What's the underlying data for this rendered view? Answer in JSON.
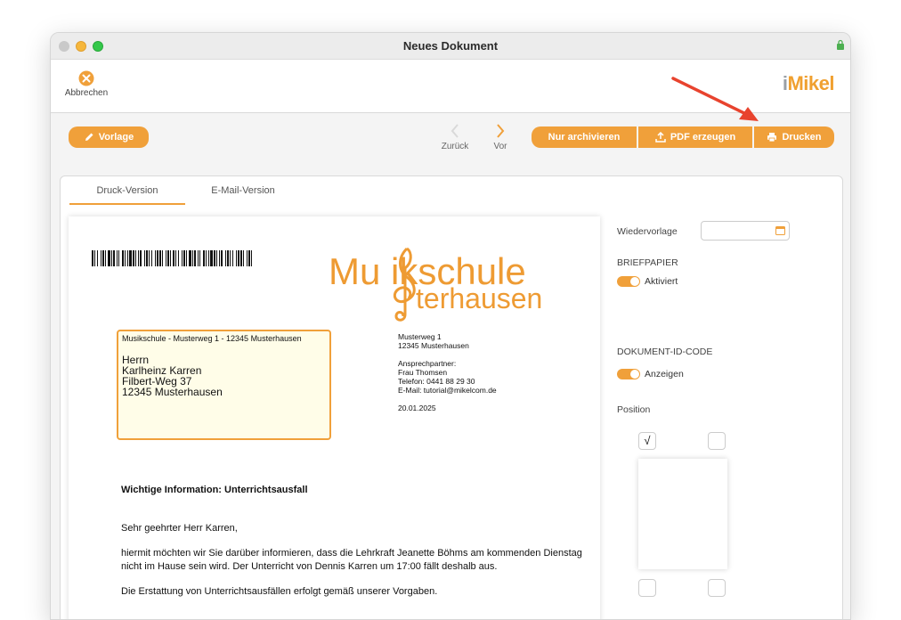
{
  "window": {
    "title": "Neues Dokument"
  },
  "toolbar": {
    "cancel_label": "Abbrechen",
    "logo_i": "i",
    "logo_text": "Mikel"
  },
  "actions": {
    "vorlage": "Vorlage",
    "zurueck": "Zurück",
    "vor": "Vor",
    "archivieren": "Nur archivieren",
    "pdf": "PDF erzeugen",
    "drucken": "Drucken"
  },
  "tabs": [
    {
      "label": "Druck-Version",
      "active": true
    },
    {
      "label": "E-Mail-Version",
      "active": false
    }
  ],
  "letter": {
    "brand_line1": "Mu ikschule",
    "brand_line2": "terhausen",
    "sender_line": "Musikschule - Musterweg 1 - 12345 Musterhausen",
    "recipient": [
      "Herrn",
      "Karlheinz Karren",
      "Filbert-Weg 37",
      "12345 Musterhausen"
    ],
    "contact_address": [
      "Musterweg 1",
      "12345 Musterhausen"
    ],
    "contact_person": [
      "Ansprechpartner:",
      "Frau Thomsen",
      "Telefon: 0441 88 29 30",
      "E-Mail: tutorial@mikelcom.de"
    ],
    "date": "20.01.2025",
    "subject": "Wichtige Information: Unterrichtsausfall",
    "salutation": "Sehr geehrter Herr Karren,",
    "paragraph1": "hiermit möchten wir Sie darüber informieren, dass die Lehrkraft Jeanette Böhms am kommenden Dienstag nicht im Hause sein wird. Der Unterricht von Dennis Karren um 17:00 fällt deshalb aus.",
    "paragraph2": "Die Erstattung von Unterrichtsausfällen erfolgt gemäß unserer Vorgaben."
  },
  "side": {
    "wiedervorlage_label": "Wiedervorlage",
    "wiedervorlage_value": "",
    "briefpapier_heading": "BRIEFPAPIER",
    "briefpapier_toggle": "Aktiviert",
    "dokid_heading": "DOKUMENT-ID-CODE",
    "dokid_toggle": "Anzeigen",
    "position_label": "Position",
    "position_check": "√"
  },
  "colors": {
    "accent": "#f0a03a",
    "brand": "#ee9b33",
    "arrow": "#e8432e"
  }
}
